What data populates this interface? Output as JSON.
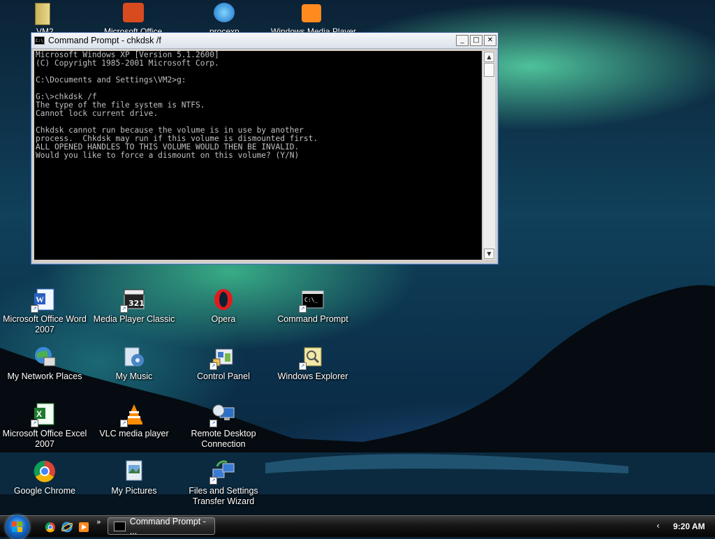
{
  "desktop": {
    "top_row_labels": [
      "VM2",
      "Microsoft Office",
      "procexp",
      "Windows Media Player"
    ],
    "icons": [
      {
        "label": "Microsoft Office Word 2007",
        "icon": "word-icon"
      },
      {
        "label": "Media Player Classic",
        "icon": "media-player-classic-icon"
      },
      {
        "label": "Opera",
        "icon": "opera-icon"
      },
      {
        "label": "Command Prompt",
        "icon": "command-prompt-icon"
      },
      {
        "label": "My Network Places",
        "icon": "network-places-icon"
      },
      {
        "label": "My Music",
        "icon": "music-icon"
      },
      {
        "label": "Control Panel",
        "icon": "control-panel-icon"
      },
      {
        "label": "Windows Explorer",
        "icon": "explorer-icon"
      },
      {
        "label": "Microsoft Office Excel 2007",
        "icon": "excel-icon"
      },
      {
        "label": "VLC media player",
        "icon": "vlc-icon"
      },
      {
        "label": "Remote Desktop Connection",
        "icon": "remote-desktop-icon"
      },
      {
        "label": "Google Chrome",
        "icon": "chrome-icon"
      },
      {
        "label": "My Pictures",
        "icon": "pictures-icon"
      },
      {
        "label": "Files and Settings Transfer Wizard",
        "icon": "transfer-wizard-icon"
      }
    ]
  },
  "window": {
    "title": "Command Prompt - chkdsk /f",
    "minimize": "_",
    "maximize": "□",
    "close": "✕",
    "lines": [
      "Microsoft Windows XP [Version 5.1.2600]",
      "(C) Copyright 1985-2001 Microsoft Corp.",
      "",
      "C:\\Documents and Settings\\VM2>g:",
      "",
      "G:\\>chkdsk /f",
      "The type of the file system is NTFS.",
      "Cannot lock current drive.",
      "",
      "Chkdsk cannot run because the volume is in use by another",
      "process.  Chkdsk may run if this volume is dismounted first.",
      "ALL OPENED HANDLES TO THIS VOLUME WOULD THEN BE INVALID.",
      "Would you like to force a dismount on this volume? (Y/N)"
    ]
  },
  "taskbar": {
    "quick_launch_more": "»",
    "task_label": "Command Prompt - ...",
    "tray_arrow": "‹",
    "clock": "9:20 AM"
  },
  "colors": {
    "console_bg": "#000000",
    "console_text": "#c0c0c0"
  }
}
